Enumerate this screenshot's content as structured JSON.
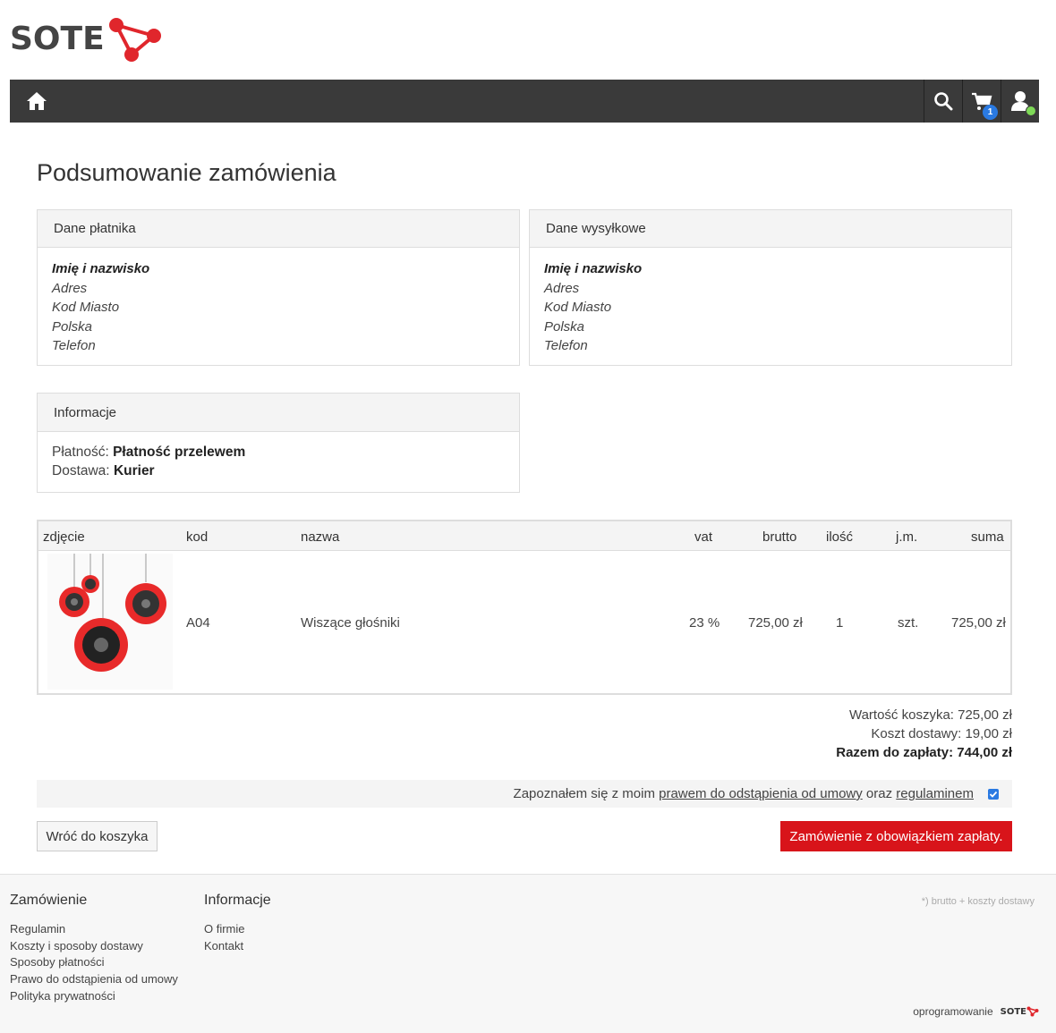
{
  "brand": {
    "name": "SOTE",
    "accent": "#d8141a"
  },
  "navbar": {
    "home_icon": "home-icon",
    "search_icon": "search-icon",
    "cart_icon": "cart-icon",
    "cart_count": "1",
    "user_icon": "user-icon"
  },
  "page_title": "Podsumowanie zamówienia",
  "payer": {
    "heading": "Dane płatnika",
    "name": "Imię i nazwisko",
    "address": "Adres",
    "city": "Kod Miasto",
    "country": "Polska",
    "phone": "Telefon"
  },
  "shipping": {
    "heading": "Dane wysyłkowe",
    "name": "Imię i nazwisko",
    "address": "Adres",
    "city": "Kod Miasto",
    "country": "Polska",
    "phone": "Telefon"
  },
  "info": {
    "heading": "Informacje",
    "payment_label": "Płatność:",
    "payment_value": "Płatność przelewem",
    "delivery_label": "Dostawa:",
    "delivery_value": "Kurier"
  },
  "table": {
    "headers": {
      "photo": "zdjęcie",
      "code": "kod",
      "name": "nazwa",
      "vat": "vat",
      "gross": "brutto",
      "qty": "ilość",
      "unit": "j.m.",
      "sum": "suma"
    },
    "row": {
      "code": "A04",
      "name": "Wiszące głośniki",
      "vat": "23 %",
      "gross": "725,00 zł",
      "qty": "1",
      "unit": "szt.",
      "sum": "725,00 zł"
    }
  },
  "totals": {
    "cart_value": "Wartość koszyka: 725,00 zł",
    "shipping_cost": "Koszt dostawy: 19,00 zł",
    "grand_total": "Razem do zapłaty: 744,00 zł"
  },
  "consent": {
    "prefix": "Zapoznałem się z moim",
    "link1": "prawem do odstąpienia od umowy",
    "middle": "oraz",
    "link2": "regulaminem",
    "checked": true
  },
  "buttons": {
    "back": "Wróć do koszyka",
    "order": "Zamówienie z obowiązkiem zapłaty."
  },
  "footer": {
    "col1": {
      "heading": "Zamówienie",
      "links": [
        "Regulamin",
        "Koszty i sposoby dostawy",
        "Sposoby płatności",
        "Prawo do odstąpienia od umowy",
        "Polityka prywatności"
      ]
    },
    "col2": {
      "heading": "Informacje",
      "links": [
        "O firmie",
        "Kontakt"
      ]
    },
    "note": "*) brutto + koszty dostawy",
    "powered_by": "oprogramowanie",
    "powered_logo": "SOTE"
  }
}
